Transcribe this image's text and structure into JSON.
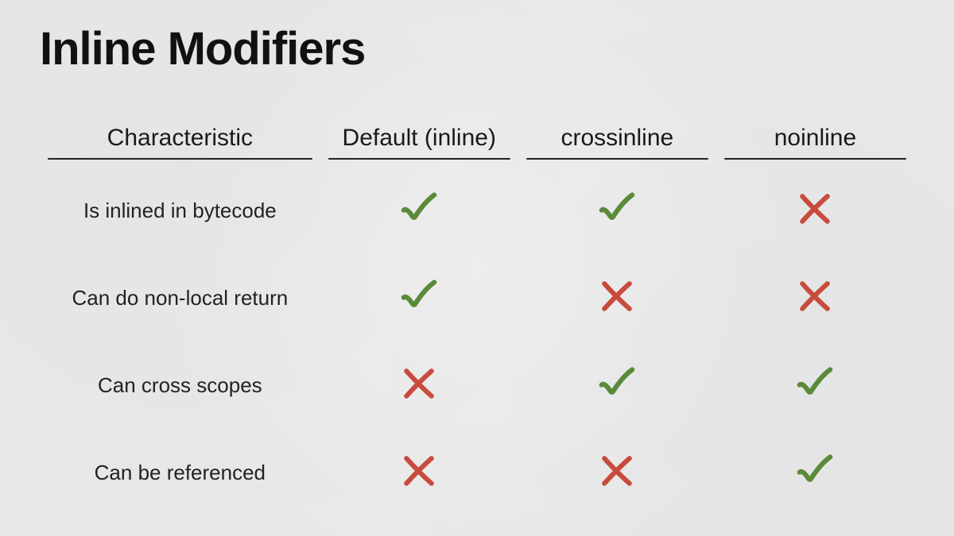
{
  "title": "Inline Modifiers",
  "colors": {
    "check": "#5a8a3a",
    "cross": "#c84b3e",
    "text": "#1a1a1a"
  },
  "chart_data": {
    "type": "table",
    "title": "Inline Modifiers",
    "columns": [
      "Characteristic",
      "Default (inline)",
      "crossinline",
      "noinline"
    ],
    "rows": [
      {
        "label": "Is inlined in bytecode",
        "values": [
          true,
          true,
          false
        ]
      },
      {
        "label": "Can do non-local return",
        "values": [
          true,
          false,
          false
        ]
      },
      {
        "label": "Can cross scopes",
        "values": [
          false,
          true,
          true
        ]
      },
      {
        "label": "Can be referenced",
        "values": [
          false,
          false,
          true
        ]
      }
    ]
  }
}
